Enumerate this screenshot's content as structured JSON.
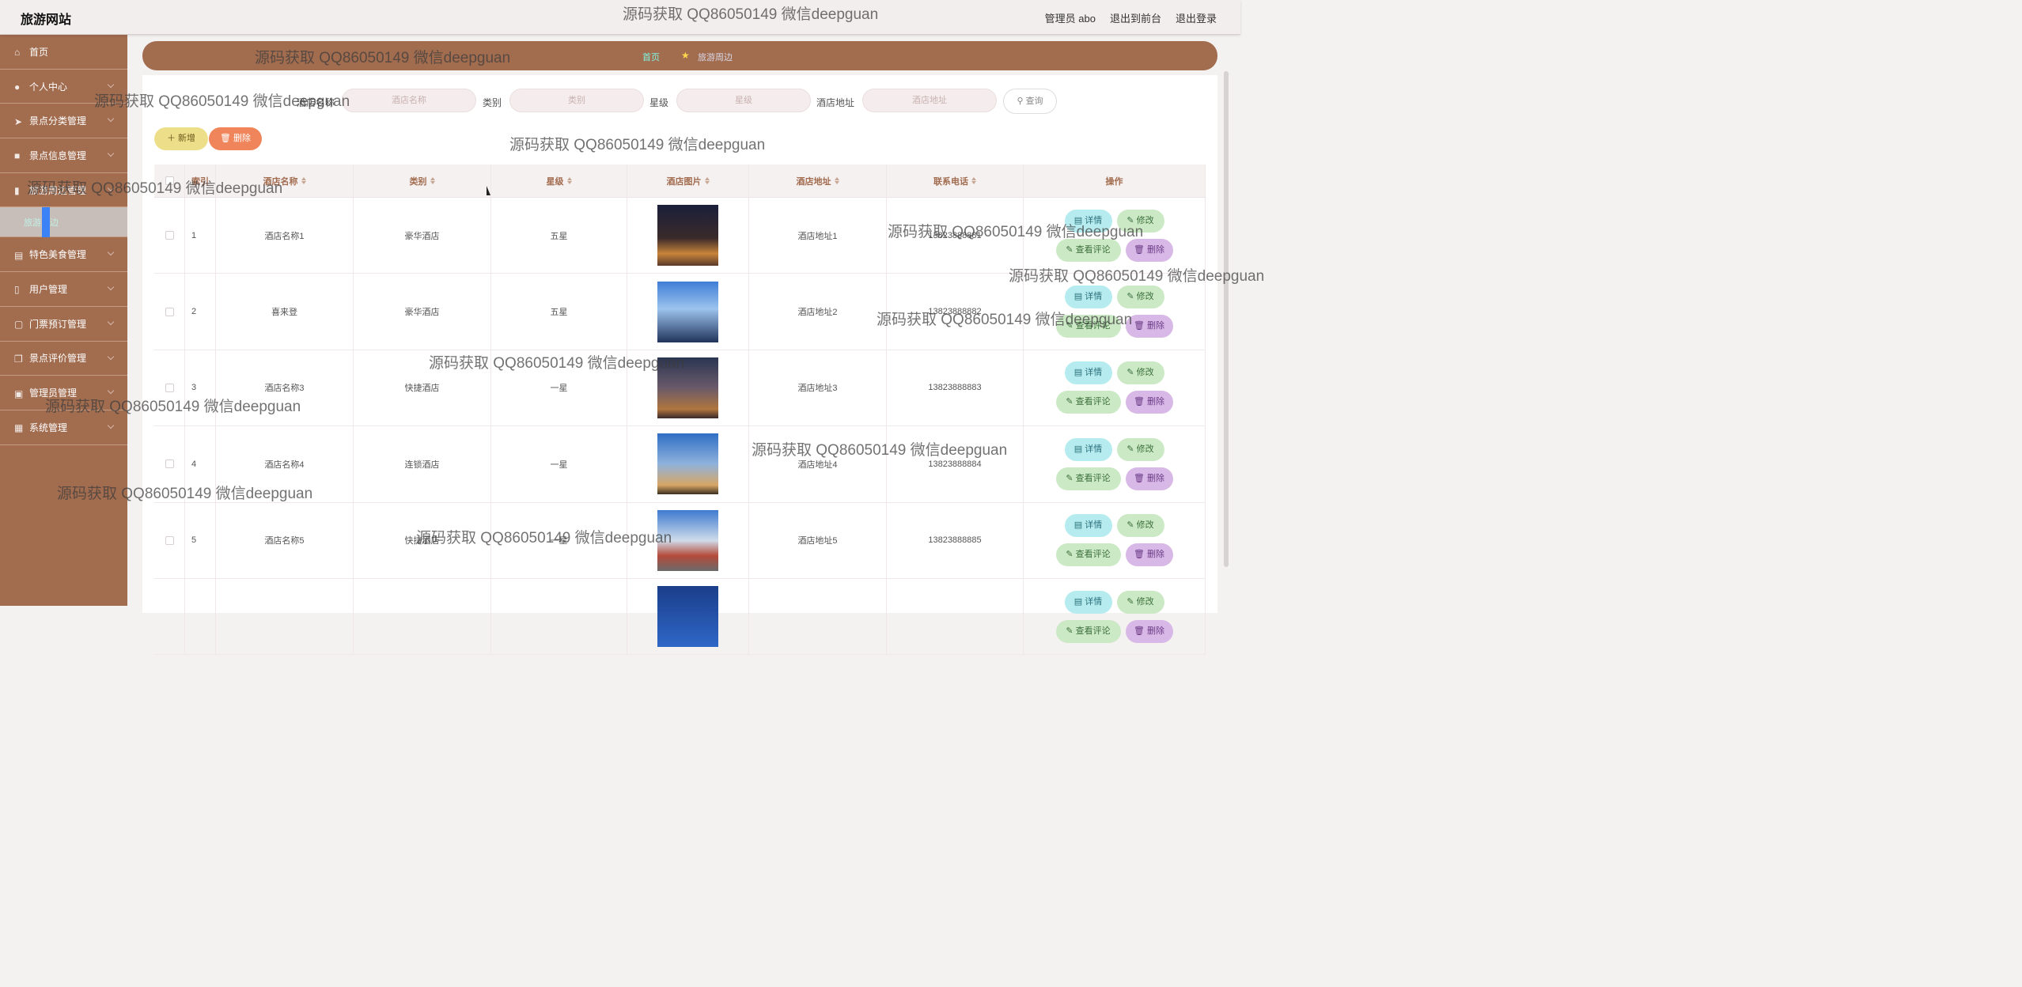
{
  "header": {
    "title": "旅游网站",
    "user": "管理员 abo",
    "to_front": "退出到前台",
    "logout": "退出登录"
  },
  "sidebar": {
    "items": [
      {
        "label": "首页"
      },
      {
        "label": "个人中心"
      },
      {
        "label": "景点分类管理"
      },
      {
        "label": "景点信息管理"
      },
      {
        "label": "旅游周边管理"
      },
      {
        "label": "特色美食管理"
      },
      {
        "label": "用户管理"
      },
      {
        "label": "门票预订管理"
      },
      {
        "label": "景点评价管理"
      },
      {
        "label": "管理员管理"
      },
      {
        "label": "系统管理"
      }
    ],
    "sub_active": "旅游周边"
  },
  "breadcrumb": {
    "home": "首页",
    "current": "旅游周边"
  },
  "search": {
    "name_label": "酒店名称",
    "name_placeholder": "酒店名称",
    "cat_label": "类别",
    "cat_placeholder": "类别",
    "star_label": "星级",
    "star_placeholder": "星级",
    "addr_label": "酒店地址",
    "addr_placeholder": "酒店地址",
    "query": "查询"
  },
  "toolbar": {
    "add": "新增",
    "delete": "删除"
  },
  "table": {
    "headers": {
      "idx": "索引",
      "name": "酒店名称",
      "cat": "类别",
      "star": "星级",
      "img": "酒店图片",
      "addr": "酒店地址",
      "tel": "联系电话",
      "op": "操作"
    },
    "ops": {
      "detail": "详情",
      "edit": "修改",
      "review": "查看评论",
      "remove": "删除"
    },
    "rows": [
      {
        "idx": "1",
        "name": "酒店名称1",
        "cat": "豪华酒店",
        "star": "五星",
        "addr": "酒店地址1",
        "tel": "13823888881"
      },
      {
        "idx": "2",
        "name": "喜来登",
        "cat": "豪华酒店",
        "star": "五星",
        "addr": "酒店地址2",
        "tel": "13823888882"
      },
      {
        "idx": "3",
        "name": "酒店名称3",
        "cat": "快捷酒店",
        "star": "一星",
        "addr": "酒店地址3",
        "tel": "13823888883"
      },
      {
        "idx": "4",
        "name": "酒店名称4",
        "cat": "连锁酒店",
        "star": "一星",
        "addr": "酒店地址4",
        "tel": "13823888884"
      },
      {
        "idx": "5",
        "name": "酒店名称5",
        "cat": "快捷酒店",
        "star": "一星",
        "addr": "酒店地址5",
        "tel": "13823888885"
      },
      {
        "idx": "",
        "name": "",
        "cat": "",
        "star": "",
        "addr": "",
        "tel": ""
      }
    ]
  },
  "watermark": "源码获取 QQ86050149 微信deepguan"
}
